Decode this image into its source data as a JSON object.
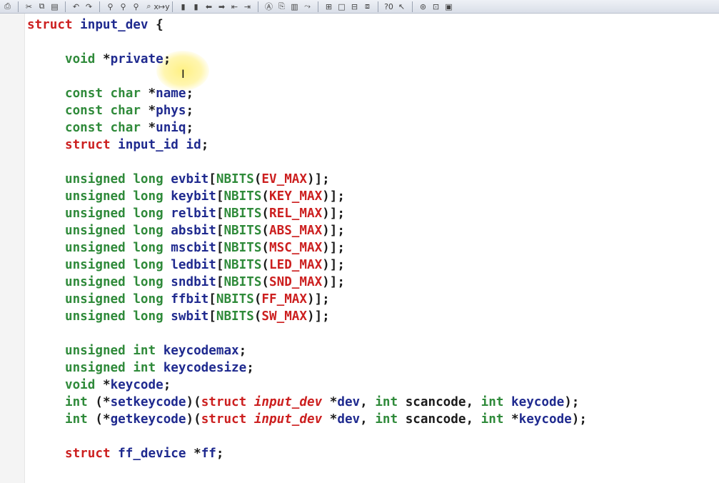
{
  "toolbar": [
    {
      "name": "print-icon",
      "glyph": "⎙"
    },
    {
      "sep": true
    },
    {
      "name": "cut-icon",
      "glyph": "✂"
    },
    {
      "name": "copy-icon",
      "glyph": "⧉"
    },
    {
      "name": "paste-icon",
      "glyph": "▤"
    },
    {
      "sep": true
    },
    {
      "name": "undo-icon",
      "glyph": "↶"
    },
    {
      "name": "redo-icon",
      "glyph": "↷"
    },
    {
      "sep": true
    },
    {
      "name": "find-icon",
      "glyph": "⚲"
    },
    {
      "name": "find-next-icon",
      "glyph": "⚲"
    },
    {
      "name": "find-prev-icon",
      "glyph": "⚲"
    },
    {
      "name": "replace-icon",
      "glyph": "⌕"
    },
    {
      "name": "replace-text-icon",
      "glyph": "x↦y"
    },
    {
      "sep": true
    },
    {
      "name": "bookmark-icon",
      "glyph": "▮"
    },
    {
      "name": "bookmark-next-icon",
      "glyph": "▮"
    },
    {
      "name": "arrow-left-icon",
      "glyph": "⬅"
    },
    {
      "name": "arrow-right-icon",
      "glyph": "➡"
    },
    {
      "name": "outdent-icon",
      "glyph": "⇤"
    },
    {
      "name": "indent-icon",
      "glyph": "⇥"
    },
    {
      "sep": true
    },
    {
      "name": "symbol-icon",
      "glyph": "Ⓐ"
    },
    {
      "name": "references-icon",
      "glyph": "⎘"
    },
    {
      "name": "book-icon",
      "glyph": "▥"
    },
    {
      "name": "jump-icon",
      "glyph": "⤳"
    },
    {
      "sep": true
    },
    {
      "name": "grid-icon",
      "glyph": "⊞"
    },
    {
      "name": "window-icon",
      "glyph": "□"
    },
    {
      "name": "tile-icon",
      "glyph": "⊟"
    },
    {
      "name": "cascade-icon",
      "glyph": "⧈"
    },
    {
      "sep": true
    },
    {
      "name": "info-icon",
      "glyph": "?0"
    },
    {
      "name": "pointer-icon",
      "glyph": "↖"
    },
    {
      "sep": true
    },
    {
      "name": "relation-icon",
      "glyph": "⊚"
    },
    {
      "name": "graph-icon",
      "glyph": "⊡"
    },
    {
      "name": "layout-icon",
      "glyph": "▣"
    }
  ],
  "code": [
    [
      {
        "c": "kw",
        "t": "struct"
      },
      {
        "c": "pt",
        "t": " "
      },
      {
        "c": "id",
        "t": "input_dev"
      },
      {
        "c": "pt",
        "t": " {"
      }
    ],
    [],
    [
      {
        "c": "ty",
        "t": "void"
      },
      {
        "c": "pt",
        "t": " *"
      },
      {
        "c": "id",
        "t": "private"
      },
      {
        "c": "pt",
        "t": ";"
      }
    ],
    [],
    [
      {
        "c": "ty",
        "t": "const char"
      },
      {
        "c": "pt",
        "t": " *"
      },
      {
        "c": "id",
        "t": "name"
      },
      {
        "c": "pt",
        "t": ";"
      }
    ],
    [
      {
        "c": "ty",
        "t": "const char"
      },
      {
        "c": "pt",
        "t": " *"
      },
      {
        "c": "id",
        "t": "phys"
      },
      {
        "c": "pt",
        "t": ";"
      }
    ],
    [
      {
        "c": "ty",
        "t": "const char"
      },
      {
        "c": "pt",
        "t": " *"
      },
      {
        "c": "id",
        "t": "uniq"
      },
      {
        "c": "pt",
        "t": ";"
      }
    ],
    [
      {
        "c": "kw",
        "t": "struct"
      },
      {
        "c": "pt",
        "t": " "
      },
      {
        "c": "id",
        "t": "input_id"
      },
      {
        "c": "pt",
        "t": " "
      },
      {
        "c": "id",
        "t": "id"
      },
      {
        "c": "pt",
        "t": ";"
      }
    ],
    [],
    [
      {
        "c": "ty",
        "t": "unsigned long"
      },
      {
        "c": "pt",
        "t": " "
      },
      {
        "c": "id",
        "t": "evbit"
      },
      {
        "c": "pt",
        "t": "["
      },
      {
        "c": "ty",
        "t": "NBITS"
      },
      {
        "c": "pt",
        "t": "("
      },
      {
        "c": "mac",
        "t": "EV_MAX"
      },
      {
        "c": "pt",
        "t": ")];"
      }
    ],
    [
      {
        "c": "ty",
        "t": "unsigned long"
      },
      {
        "c": "pt",
        "t": " "
      },
      {
        "c": "id",
        "t": "keybit"
      },
      {
        "c": "pt",
        "t": "["
      },
      {
        "c": "ty",
        "t": "NBITS"
      },
      {
        "c": "pt",
        "t": "("
      },
      {
        "c": "mac",
        "t": "KEY_MAX"
      },
      {
        "c": "pt",
        "t": ")];"
      }
    ],
    [
      {
        "c": "ty",
        "t": "unsigned long"
      },
      {
        "c": "pt",
        "t": " "
      },
      {
        "c": "id",
        "t": "relbit"
      },
      {
        "c": "pt",
        "t": "["
      },
      {
        "c": "ty",
        "t": "NBITS"
      },
      {
        "c": "pt",
        "t": "("
      },
      {
        "c": "mac",
        "t": "REL_MAX"
      },
      {
        "c": "pt",
        "t": ")];"
      }
    ],
    [
      {
        "c": "ty",
        "t": "unsigned long"
      },
      {
        "c": "pt",
        "t": " "
      },
      {
        "c": "id",
        "t": "absbit"
      },
      {
        "c": "pt",
        "t": "["
      },
      {
        "c": "ty",
        "t": "NBITS"
      },
      {
        "c": "pt",
        "t": "("
      },
      {
        "c": "mac",
        "t": "ABS_MAX"
      },
      {
        "c": "pt",
        "t": ")];"
      }
    ],
    [
      {
        "c": "ty",
        "t": "unsigned long"
      },
      {
        "c": "pt",
        "t": " "
      },
      {
        "c": "id",
        "t": "mscbit"
      },
      {
        "c": "pt",
        "t": "["
      },
      {
        "c": "ty",
        "t": "NBITS"
      },
      {
        "c": "pt",
        "t": "("
      },
      {
        "c": "mac",
        "t": "MSC_MAX"
      },
      {
        "c": "pt",
        "t": ")];"
      }
    ],
    [
      {
        "c": "ty",
        "t": "unsigned long"
      },
      {
        "c": "pt",
        "t": " "
      },
      {
        "c": "id",
        "t": "ledbit"
      },
      {
        "c": "pt",
        "t": "["
      },
      {
        "c": "ty",
        "t": "NBITS"
      },
      {
        "c": "pt",
        "t": "("
      },
      {
        "c": "mac",
        "t": "LED_MAX"
      },
      {
        "c": "pt",
        "t": ")];"
      }
    ],
    [
      {
        "c": "ty",
        "t": "unsigned long"
      },
      {
        "c": "pt",
        "t": " "
      },
      {
        "c": "id",
        "t": "sndbit"
      },
      {
        "c": "pt",
        "t": "["
      },
      {
        "c": "ty",
        "t": "NBITS"
      },
      {
        "c": "pt",
        "t": "("
      },
      {
        "c": "mac",
        "t": "SND_MAX"
      },
      {
        "c": "pt",
        "t": ")];"
      }
    ],
    [
      {
        "c": "ty",
        "t": "unsigned long"
      },
      {
        "c": "pt",
        "t": " "
      },
      {
        "c": "id",
        "t": "ffbit"
      },
      {
        "c": "pt",
        "t": "["
      },
      {
        "c": "ty",
        "t": "NBITS"
      },
      {
        "c": "pt",
        "t": "("
      },
      {
        "c": "mac",
        "t": "FF_MAX"
      },
      {
        "c": "pt",
        "t": ")];"
      }
    ],
    [
      {
        "c": "ty",
        "t": "unsigned long"
      },
      {
        "c": "pt",
        "t": " "
      },
      {
        "c": "id",
        "t": "swbit"
      },
      {
        "c": "pt",
        "t": "["
      },
      {
        "c": "ty",
        "t": "NBITS"
      },
      {
        "c": "pt",
        "t": "("
      },
      {
        "c": "mac",
        "t": "SW_MAX"
      },
      {
        "c": "pt",
        "t": ")];"
      }
    ],
    [],
    [
      {
        "c": "ty",
        "t": "unsigned int"
      },
      {
        "c": "pt",
        "t": " "
      },
      {
        "c": "id",
        "t": "keycodemax"
      },
      {
        "c": "pt",
        "t": ";"
      }
    ],
    [
      {
        "c": "ty",
        "t": "unsigned int"
      },
      {
        "c": "pt",
        "t": " "
      },
      {
        "c": "id",
        "t": "keycodesize"
      },
      {
        "c": "pt",
        "t": ";"
      }
    ],
    [
      {
        "c": "ty",
        "t": "void"
      },
      {
        "c": "pt",
        "t": " *"
      },
      {
        "c": "id",
        "t": "keycode"
      },
      {
        "c": "pt",
        "t": ";"
      }
    ],
    [
      {
        "c": "ty",
        "t": "int"
      },
      {
        "c": "pt",
        "t": " (*"
      },
      {
        "c": "id",
        "t": "setkeycode"
      },
      {
        "c": "pt",
        "t": ")("
      },
      {
        "c": "kw",
        "t": "struct"
      },
      {
        "c": "pt",
        "t": " "
      },
      {
        "c": "it",
        "t": "input_dev"
      },
      {
        "c": "pt",
        "t": " *"
      },
      {
        "c": "id",
        "t": "dev"
      },
      {
        "c": "pt",
        "t": ", "
      },
      {
        "c": "ty",
        "t": "int"
      },
      {
        "c": "pt",
        "t": " scancode, "
      },
      {
        "c": "ty",
        "t": "int"
      },
      {
        "c": "pt",
        "t": " "
      },
      {
        "c": "id",
        "t": "keycode"
      },
      {
        "c": "pt",
        "t": ");"
      }
    ],
    [
      {
        "c": "ty",
        "t": "int"
      },
      {
        "c": "pt",
        "t": " (*"
      },
      {
        "c": "id",
        "t": "getkeycode"
      },
      {
        "c": "pt",
        "t": ")("
      },
      {
        "c": "kw",
        "t": "struct"
      },
      {
        "c": "pt",
        "t": " "
      },
      {
        "c": "it",
        "t": "input_dev"
      },
      {
        "c": "pt",
        "t": " *"
      },
      {
        "c": "id",
        "t": "dev"
      },
      {
        "c": "pt",
        "t": ", "
      },
      {
        "c": "ty",
        "t": "int"
      },
      {
        "c": "pt",
        "t": " scancode, "
      },
      {
        "c": "ty",
        "t": "int"
      },
      {
        "c": "pt",
        "t": " *"
      },
      {
        "c": "id",
        "t": "keycode"
      },
      {
        "c": "pt",
        "t": ");"
      }
    ],
    [],
    [
      {
        "c": "kw",
        "t": "struct"
      },
      {
        "c": "pt",
        "t": " "
      },
      {
        "c": "id",
        "t": "ff_device"
      },
      {
        "c": "pt",
        "t": " *"
      },
      {
        "c": "id",
        "t": "ff"
      },
      {
        "c": "pt",
        "t": ";"
      }
    ]
  ],
  "colors": {
    "keyword": "#cc1f1f",
    "type": "#2f8a3a",
    "identifier": "#1f2a8f",
    "macro": "#cc1f1f",
    "punctuation": "#1b1b1b"
  }
}
